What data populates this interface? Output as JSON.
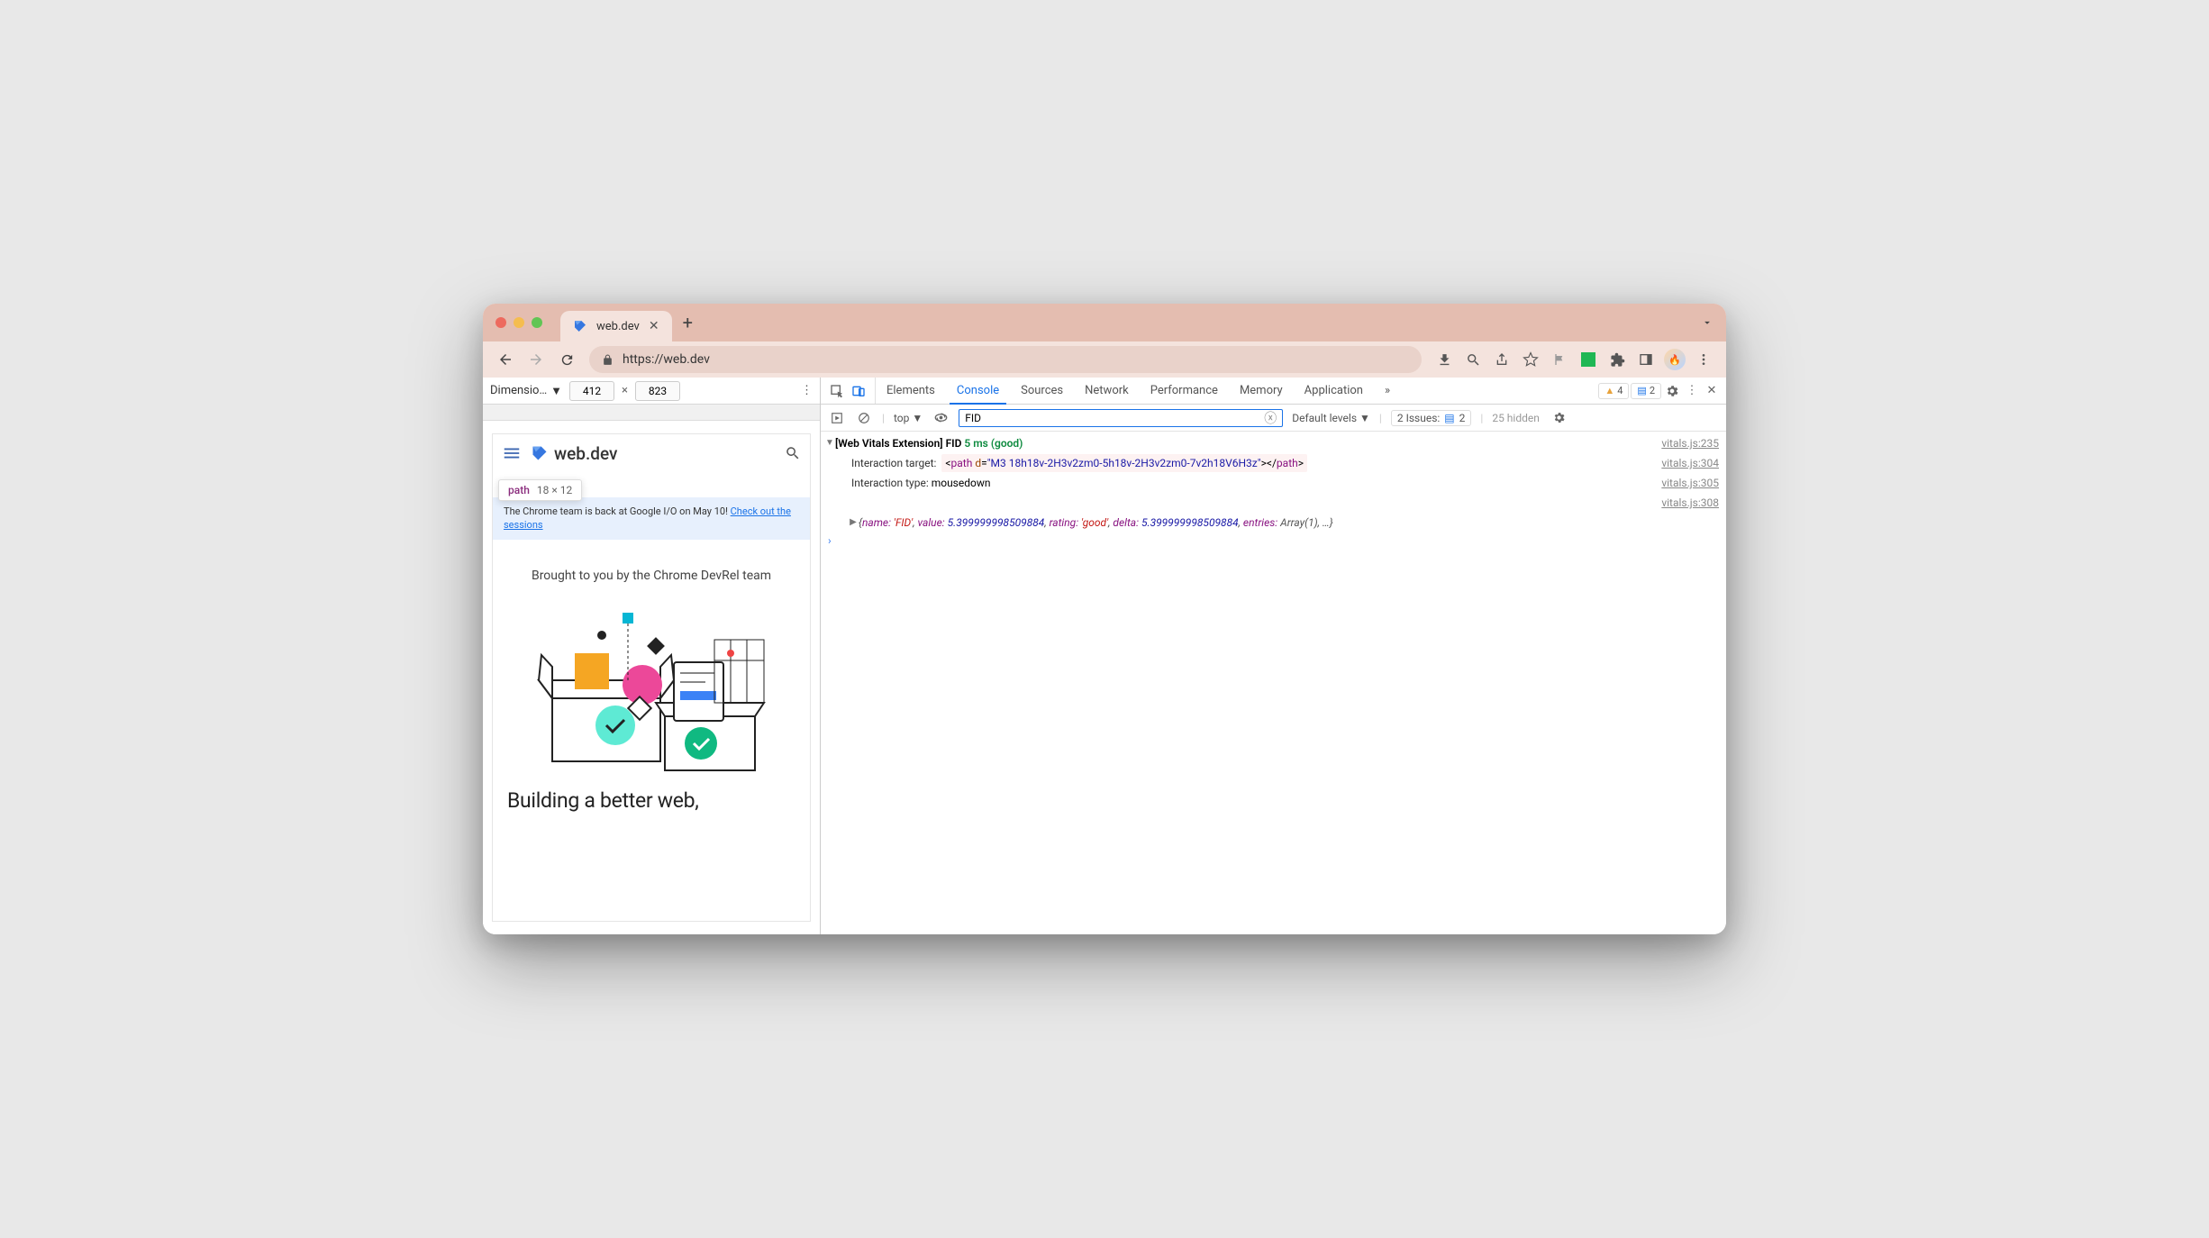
{
  "browser": {
    "tab_title": "web.dev",
    "url": "https://web.dev"
  },
  "dimensions": {
    "label": "Dimensio…",
    "width": "412",
    "height": "823"
  },
  "preview": {
    "site_name": "web.dev",
    "tooltip_name": "path",
    "tooltip_size": "18 × 12",
    "banner_text": "The Chrome team is back at Google I/O on May 10! ",
    "banner_link": "Check out the sessions",
    "brought": "Brought to you by the Chrome DevRel team",
    "heading": "Building a better web,"
  },
  "devtools": {
    "tabs": [
      "Elements",
      "Console",
      "Sources",
      "Network",
      "Performance",
      "Memory",
      "Application"
    ],
    "active_tab": "Console",
    "warn_count": "4",
    "msg_count": "2",
    "console_bar": {
      "context": "top",
      "filter": "FID",
      "levels": "Default levels",
      "issues_label": "2 Issues:",
      "issues_count": "2",
      "hidden": "25 hidden"
    },
    "logs": {
      "l1_prefix": "[Web Vitals Extension] FID",
      "l1_val": "5 ms (good)",
      "l1_src": "vitals.js:235",
      "l2_label": "Interaction target:",
      "l2_tag": "path",
      "l2_attr": "d",
      "l2_val": "\"M3 18h18v-2H3v2zm0-5h18v-2H3v2zm0-7v2h18V6H3z\"",
      "l2_src": "vitals.js:304",
      "l3_label": "Interaction type: ",
      "l3_val": "mousedown",
      "l3_src": "vitals.js:305",
      "l4_src": "vitals.js:308",
      "l4_obj_name": "name:",
      "l4_obj_name_v": "'FID'",
      "l4_obj_value": "value:",
      "l4_obj_value_v": "5.399999998509884",
      "l4_obj_rating": "rating:",
      "l4_obj_rating_v": "'good'",
      "l4_obj_delta": "delta:",
      "l4_obj_delta_v": "5.399999998509884",
      "l4_obj_entries": "entries:",
      "l4_obj_entries_v": "Array(1)",
      "l4_obj_tail": ", …}"
    }
  }
}
